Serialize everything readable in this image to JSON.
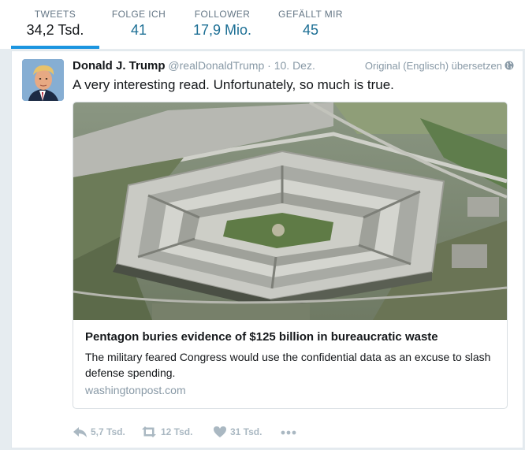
{
  "stats": [
    {
      "label": "TWEETS",
      "value": "34,2 Tsd."
    },
    {
      "label": "FOLGE ICH",
      "value": "41"
    },
    {
      "label": "FOLLOWER",
      "value": "17,9 Mio."
    },
    {
      "label": "GEFÄLLT MIR",
      "value": "45"
    }
  ],
  "tweet": {
    "fullname": "Donald J. Trump",
    "handle": "@realDonaldTrump",
    "separator": "·",
    "time": "10. Dez.",
    "translate": "Original (Englisch) übersetzen",
    "text": "A very interesting read. Unfortunately, so much is true.",
    "card": {
      "title": "Pentagon buries evidence of $125 billion in bureaucratic waste",
      "description": "The military feared Congress would use the confidential data as an excuse to slash defense spending.",
      "domain": "washingtonpost.com"
    },
    "actions": {
      "replies": "5,7 Tsd.",
      "retweets": "12 Tsd.",
      "likes": "31 Tsd."
    }
  },
  "colors": {
    "accent": "#1b95e0",
    "link": "#1b6e94",
    "muted": "#8899a6"
  },
  "icons": [
    "globe-icon",
    "reply-icon",
    "retweet-icon",
    "heart-icon",
    "more-icon"
  ]
}
